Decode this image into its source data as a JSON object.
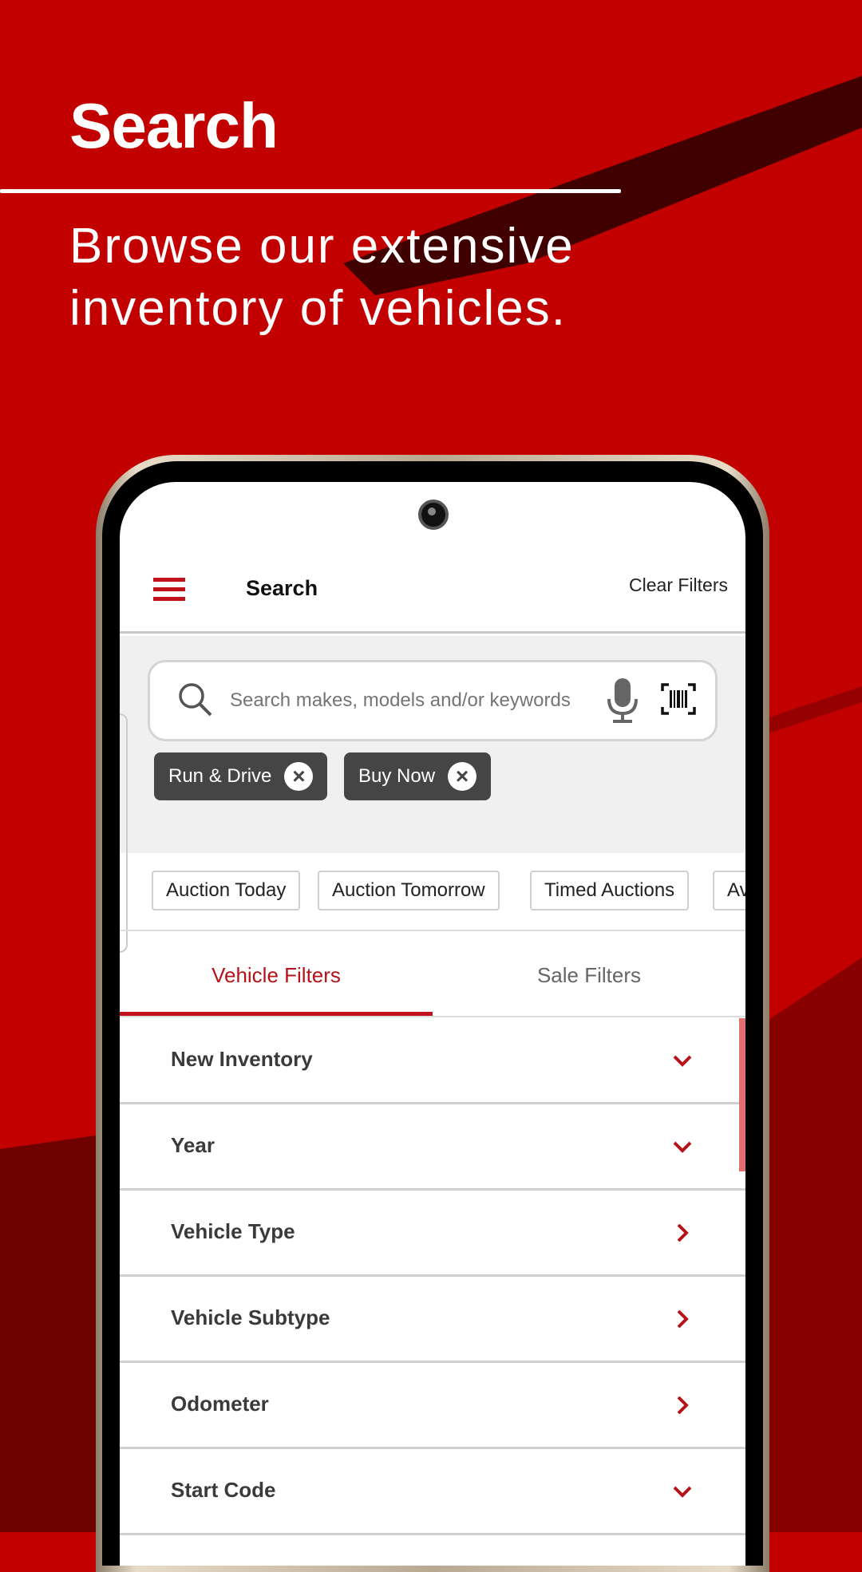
{
  "promo": {
    "title": "Search",
    "subtitle": "Browse our extensive inventory of vehicles."
  },
  "colors": {
    "brand_red": "#c30000",
    "accent": "#c0121a",
    "chip_bg": "#454545"
  },
  "app": {
    "header": {
      "menu_icon": "hamburger-icon",
      "title": "Search",
      "clear_filters": "Clear Filters"
    },
    "search": {
      "placeholder": "Search makes, models and/or keywords",
      "value": ""
    },
    "active_filters": [
      {
        "label": "Run & Drive"
      },
      {
        "label": "Buy Now"
      }
    ],
    "quick_filters": [
      "Auction Today",
      "Auction Tomorrow",
      "Timed Auctions",
      "Ava"
    ],
    "tabs": [
      {
        "label": "Vehicle Filters",
        "active": true
      },
      {
        "label": "Sale Filters",
        "active": false
      }
    ],
    "filters": [
      {
        "label": "New Inventory",
        "icon": "chevron-down"
      },
      {
        "label": "Year",
        "icon": "chevron-down"
      },
      {
        "label": "Vehicle Type",
        "icon": "chevron-right"
      },
      {
        "label": "Vehicle Subtype",
        "icon": "chevron-right"
      },
      {
        "label": "Odometer",
        "icon": "chevron-right"
      },
      {
        "label": "Start Code",
        "icon": "chevron-down"
      }
    ]
  }
}
